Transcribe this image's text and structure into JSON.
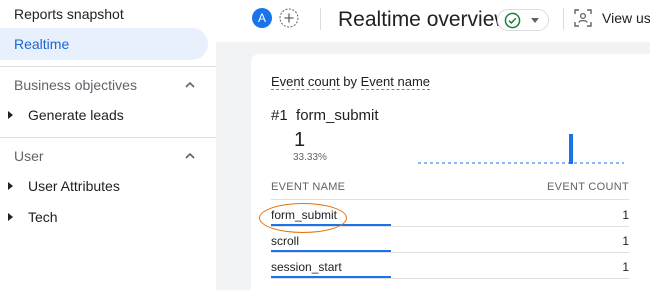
{
  "sidebar": {
    "reports_snapshot": "Reports snapshot",
    "realtime": "Realtime",
    "sections": [
      {
        "title": "Business objectives",
        "items": [
          "Generate leads"
        ]
      },
      {
        "title": "User",
        "items": [
          "User Attributes",
          "Tech"
        ]
      }
    ]
  },
  "header": {
    "avatar_letter": "A",
    "title": "Realtime overview",
    "view_label": "View use"
  },
  "card": {
    "heading_metric": "Event count",
    "heading_by": "by",
    "heading_dimension": "Event name",
    "top_rank": "#1",
    "top_name": "form_submit",
    "top_count": "1",
    "top_percent": "33.33%",
    "columns": {
      "name": "EVENT NAME",
      "count": "EVENT COUNT"
    },
    "rows": [
      {
        "name": "form_submit",
        "count": "1"
      },
      {
        "name": "scroll",
        "count": "1"
      },
      {
        "name": "session_start",
        "count": "1"
      }
    ]
  },
  "colors": {
    "accent": "#1a73e8",
    "active_nav_bg": "#e8f0fe",
    "status_green": "#188038",
    "highlight_orange": "#e8710a"
  },
  "icons": {
    "expand_section": "chevron-up-icon",
    "tree_expand": "triangle-right-icon",
    "add_comparison": "plus-circle-icon",
    "status_ok": "check-circle-icon",
    "dropdown": "caret-down-icon",
    "view_user": "user-snapshot-icon"
  }
}
